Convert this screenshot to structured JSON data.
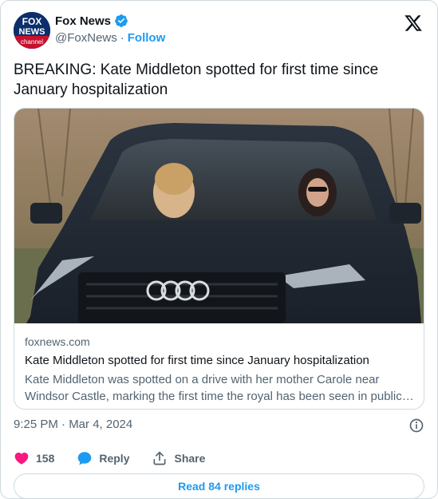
{
  "account": {
    "display_name": "Fox News",
    "handle": "@FoxNews",
    "separator": "·",
    "follow_label": "Follow",
    "avatar_text_top": "FOX",
    "avatar_text_mid": "NEWS",
    "avatar_text_bottom": "channel"
  },
  "tweet": {
    "text": "BREAKING: Kate Middleton spotted for first time since January hospitalization"
  },
  "link_card": {
    "domain": "foxnews.com",
    "title": "Kate Middleton spotted for first time since January hospitalization",
    "description": "Kate Middleton was spotted on a drive with her mother Carole near Windsor Castle, marking the first time the royal has been seen in public since her January hospitalization.",
    "image_subject": "dark SUV with two women seated in front, winter trees behind"
  },
  "meta": {
    "timestamp": "9:25 PM · Mar 4, 2024"
  },
  "actions": {
    "like_count": "158",
    "reply_label": "Reply",
    "share_label": "Share"
  },
  "footer": {
    "read_replies_label": "Read 84 replies"
  },
  "colors": {
    "accent": "#1d9bf0",
    "like": "#f91880",
    "text_secondary": "#536471",
    "border": "#cfd9de"
  }
}
